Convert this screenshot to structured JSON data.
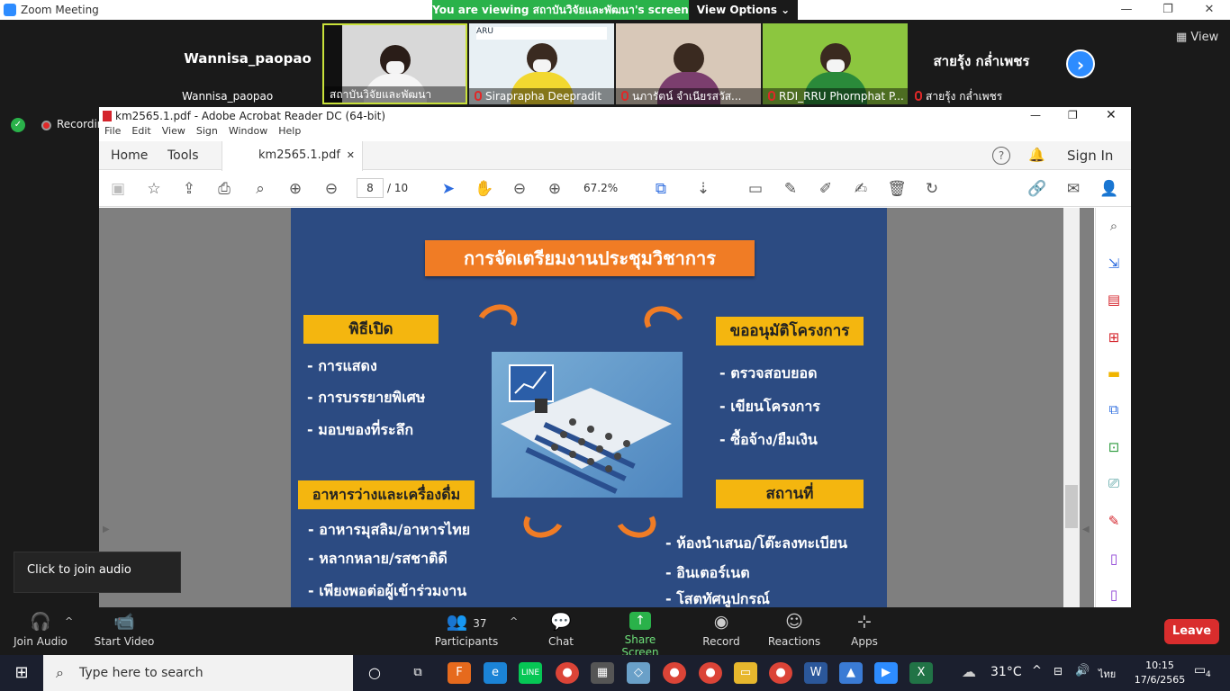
{
  "zoom": {
    "window_title": "Zoom Meeting",
    "viewing_banner": "You are viewing สถาบันวิจัยและพัฒนา's screen",
    "view_options": "View Options ⌄",
    "view_button": "View",
    "recording_label": "Recordin"
  },
  "participants": [
    {
      "big_name": "Wannisa_paopao",
      "label": "Wannisa_paopao",
      "muted": false,
      "tile": "name-only"
    },
    {
      "label": "สถาบันวิจัยและพัฒนา",
      "muted": false,
      "tile": "video"
    },
    {
      "label": "Siraprapha Deepradit",
      "muted": true,
      "tile": "video"
    },
    {
      "label": "นภารัตน์ จำเนียรสวัส...",
      "muted": true,
      "tile": "video"
    },
    {
      "label": "RDI_RRU Phornphat P...",
      "muted": true,
      "tile": "video"
    },
    {
      "big_name": "สายรุ้ง กล่ำเพชร",
      "label": "สายรุ้ง กล่ำเพชร",
      "muted": true,
      "tile": "name-only"
    }
  ],
  "acrobat": {
    "title": "km2565.1.pdf - Adobe Acrobat Reader DC (64-bit)",
    "menu": [
      "File",
      "Edit",
      "View",
      "Sign",
      "Window",
      "Help"
    ],
    "tabs": {
      "home": "Home",
      "tools": "Tools",
      "doc": "km2565.1.pdf",
      "sign_in": "Sign In"
    },
    "page_current": "8",
    "page_total": "/  10",
    "zoom": "67.2%"
  },
  "slide": {
    "title": "การจัดเตรียมงานประชุมวิชาการ",
    "sections": [
      {
        "heading": "พิธีเปิด",
        "items": [
          "- การแสดง",
          "- การบรรยายพิเศษ",
          "- มอบของที่ระลึก"
        ]
      },
      {
        "heading": "ขออนุมัติโครงการ",
        "items": [
          "- ตรวจสอบยอด",
          "- เขียนโครงการ",
          "- ซื้อจ้าง/ยืมเงิน"
        ]
      },
      {
        "heading": "อาหารว่างและเครื่องดื่ม",
        "items": [
          "- อาหารมุสลิม/อาหารไทย",
          "- หลากหลาย/รสชาติดี",
          "- เพียงพอต่อผู้เข้าร่วมงาน"
        ]
      },
      {
        "heading": "สถานที่",
        "items": [
          "- ห้องนำเสนอ/โต๊ะลงทะเบียน",
          "- อินเตอร์เนต",
          "- โสตทัศนูปกรณ์"
        ]
      }
    ]
  },
  "join_tooltip": "Click to join audio",
  "bottom_bar": {
    "join_audio": "Join Audio",
    "start_video": "Start Video",
    "participants": "Participants",
    "participants_count": "37",
    "chat": "Chat",
    "share_screen": "Share Screen",
    "record": "Record",
    "reactions": "Reactions",
    "apps": "Apps",
    "leave": "Leave"
  },
  "taskbar": {
    "search_placeholder": "Type here to search",
    "temperature": "31°C",
    "language": "ไทย",
    "time": "10:15",
    "date": "17/6/2565",
    "notification_count": "4"
  },
  "colors": {
    "zoom_green": "#2ab24a",
    "zoom_blue": "#2d8cff",
    "slide_bg": "#2c4b82",
    "slide_title_bg": "#f07c25",
    "heading_bg": "#f4b60f",
    "leave_red": "#d92d2d"
  }
}
